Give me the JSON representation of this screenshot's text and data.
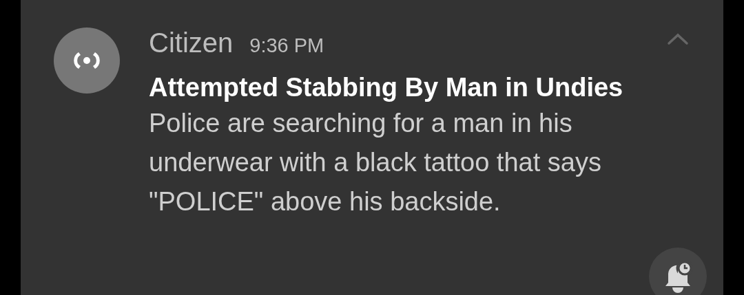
{
  "notification": {
    "app_name": "Citizen",
    "time": "9:36 PM",
    "expanded": true,
    "title": "Attempted Stabbing By Man in Undies",
    "body": "Police are searching for a man in his underwear with a black tattoo that says \"POLICE\" above his backside."
  }
}
